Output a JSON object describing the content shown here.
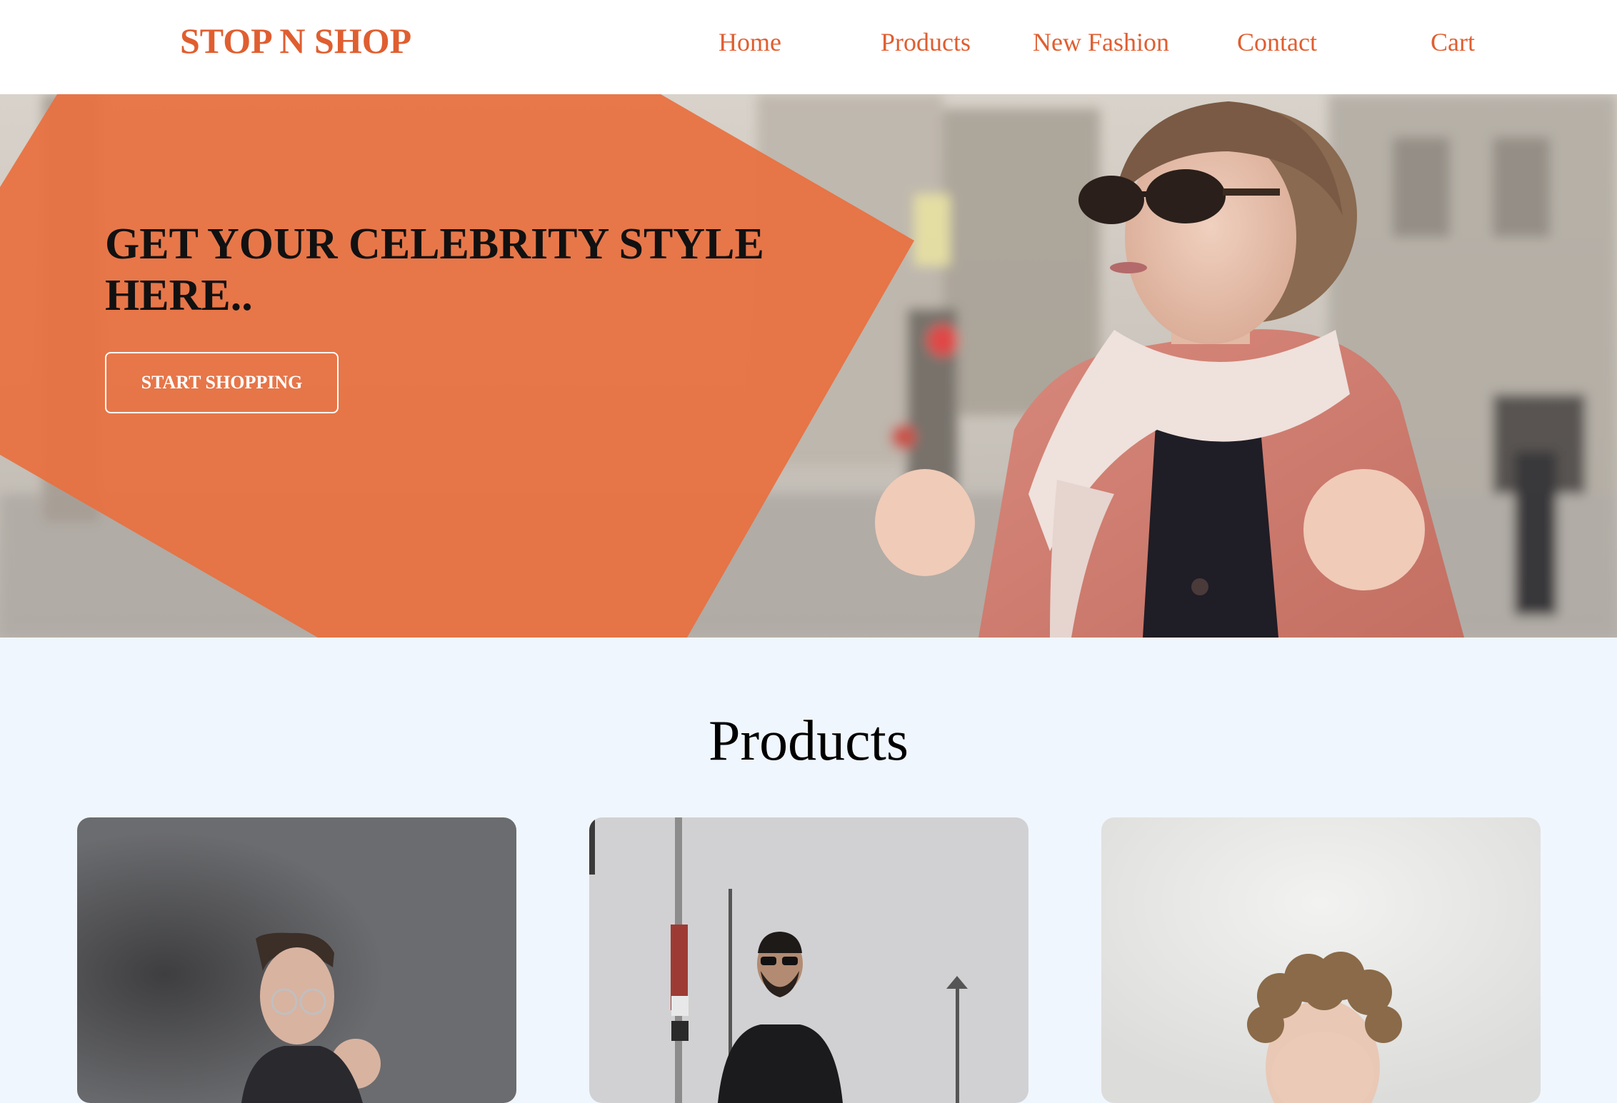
{
  "navbar": {
    "logo": "STOP N SHOP",
    "links": [
      {
        "label": "Home"
      },
      {
        "label": "Products"
      },
      {
        "label": "New Fashion"
      },
      {
        "label": "Contact"
      },
      {
        "label": "Cart"
      }
    ]
  },
  "hero": {
    "title": "GET YOUR CELEBRITY STYLE HERE..",
    "button_label": "START SHOPPING"
  },
  "products": {
    "heading": "Products"
  },
  "colors": {
    "accent": "#e05e30",
    "hero_overlay": "#e8703f",
    "section_background": "#f0f6fd",
    "navbar_background": "#ffffff"
  }
}
